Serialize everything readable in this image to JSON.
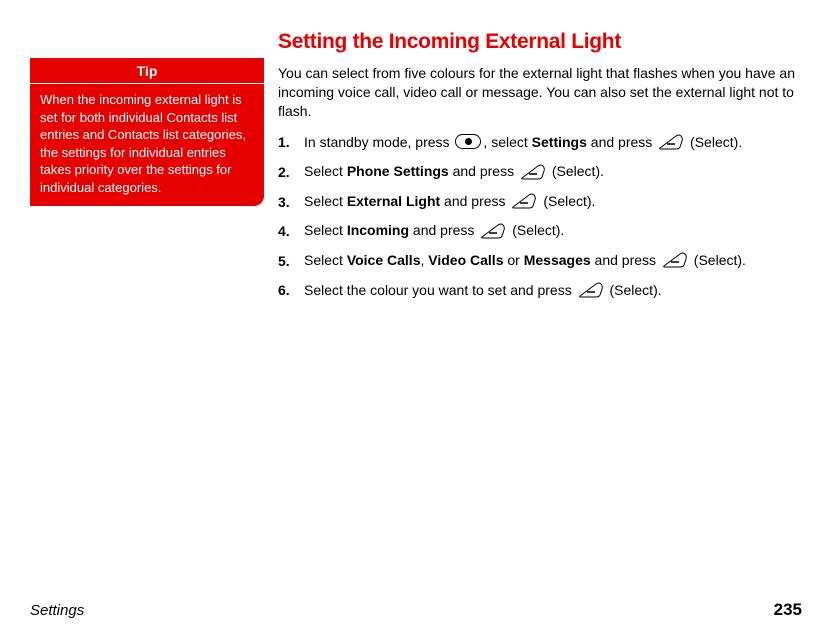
{
  "tip": {
    "header": "Tip",
    "body": "When the incoming external light is set for both individual Contacts list entries and Contacts list categories, the settings for individual entries takes priority over the settings for individual categories."
  },
  "title": "Setting the Incoming External Light",
  "intro": "You can select from five colours for the external light that flashes when you have an incoming voice call, video call or message. You can also set the external light not to flash.",
  "steps": [
    {
      "num": "1.",
      "parts": [
        {
          "t": "text",
          "v": "In standby mode, press "
        },
        {
          "t": "icon",
          "v": "center-key"
        },
        {
          "t": "text",
          "v": ", select "
        },
        {
          "t": "bold",
          "v": "Settings"
        },
        {
          "t": "text",
          "v": " and press "
        },
        {
          "t": "icon",
          "v": "softkey"
        },
        {
          "t": "text",
          "v": " (Select)."
        }
      ]
    },
    {
      "num": "2.",
      "parts": [
        {
          "t": "text",
          "v": "Select "
        },
        {
          "t": "bold",
          "v": "Phone Settings"
        },
        {
          "t": "text",
          "v": " and press "
        },
        {
          "t": "icon",
          "v": "softkey"
        },
        {
          "t": "text",
          "v": " (Select)."
        }
      ]
    },
    {
      "num": "3.",
      "parts": [
        {
          "t": "text",
          "v": "Select "
        },
        {
          "t": "bold",
          "v": "External Light"
        },
        {
          "t": "text",
          "v": " and press "
        },
        {
          "t": "icon",
          "v": "softkey"
        },
        {
          "t": "text",
          "v": " (Select)."
        }
      ]
    },
    {
      "num": "4.",
      "parts": [
        {
          "t": "text",
          "v": "Select "
        },
        {
          "t": "bold",
          "v": "Incoming"
        },
        {
          "t": "text",
          "v": " and press "
        },
        {
          "t": "icon",
          "v": "softkey"
        },
        {
          "t": "text",
          "v": " (Select)."
        }
      ]
    },
    {
      "num": "5.",
      "parts": [
        {
          "t": "text",
          "v": "Select "
        },
        {
          "t": "bold",
          "v": "Voice Calls"
        },
        {
          "t": "text",
          "v": ", "
        },
        {
          "t": "bold",
          "v": "Video Calls"
        },
        {
          "t": "text",
          "v": " or "
        },
        {
          "t": "bold",
          "v": "Messages"
        },
        {
          "t": "text",
          "v": " and press "
        },
        {
          "t": "icon",
          "v": "softkey"
        },
        {
          "t": "text",
          "v": " (Select)."
        }
      ]
    },
    {
      "num": "6.",
      "parts": [
        {
          "t": "text",
          "v": "Select the colour you want to set and press "
        },
        {
          "t": "icon",
          "v": "softkey"
        },
        {
          "t": "text",
          "v": " (Select)."
        }
      ]
    }
  ],
  "footer": {
    "section": "Settings",
    "page": "235"
  }
}
